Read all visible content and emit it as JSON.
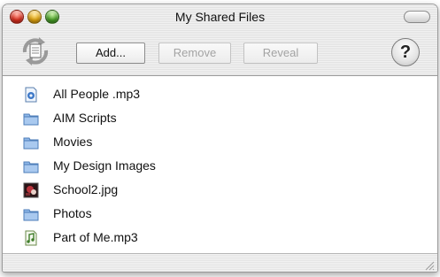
{
  "window": {
    "title": "My Shared Files"
  },
  "toolbar": {
    "add_label": "Add...",
    "remove_label": "Remove",
    "reveal_label": "Reveal",
    "help_label": "?"
  },
  "files": [
    {
      "name": "All People .mp3",
      "icon": "audio-doc-icon"
    },
    {
      "name": "AIM Scripts",
      "icon": "folder-icon"
    },
    {
      "name": "Movies",
      "icon": "folder-icon"
    },
    {
      "name": "My Design Images",
      "icon": "folder-icon"
    },
    {
      "name": "School2.jpg",
      "icon": "image-thumbnail-icon"
    },
    {
      "name": "Photos",
      "icon": "folder-icon"
    },
    {
      "name": "Part of Me.mp3",
      "icon": "music-file-icon"
    }
  ],
  "colors": {
    "folder": "#8fb8e8",
    "close": "#e0301f",
    "minimize": "#e6a80f",
    "zoom": "#4aa427"
  }
}
